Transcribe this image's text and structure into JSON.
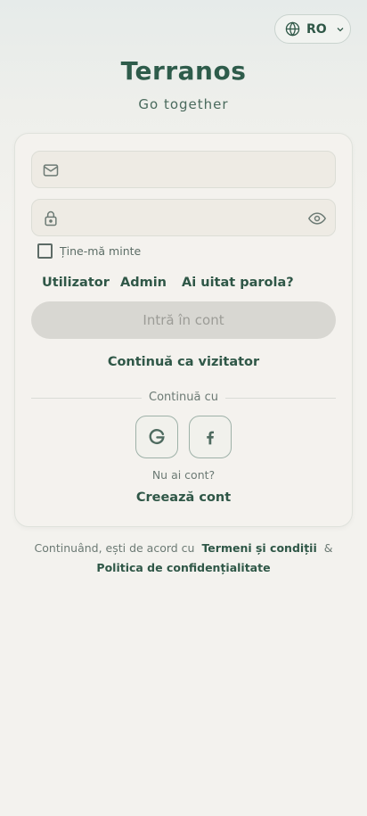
{
  "language": {
    "code": "RO",
    "icon": "globe-icon"
  },
  "app": {
    "title": "Terranos",
    "subtitle": "Go together"
  },
  "login": {
    "email": {
      "value": "",
      "placeholder": "",
      "icon": "mail-icon"
    },
    "password": {
      "value": "",
      "placeholder": "",
      "icon": "lock-icon",
      "toggle_icon": "eye-icon"
    },
    "remember_me": {
      "label": "Ține-mă minte",
      "checked": false
    },
    "role_links": [
      "Utilizator",
      "Admin"
    ],
    "forgot_password": "Ai uitat parola?",
    "submit": "Intră în cont",
    "guest": "Continuă ca vizitator",
    "divider": "Continuă cu",
    "social": [
      "google-icon",
      "facebook-icon"
    ],
    "no_account": "Nu ai cont?",
    "create_account": "Creează cont"
  },
  "legal": {
    "prefix": "Continuând, ești de acord cu",
    "terms": "Termeni și condiții",
    "and": "&",
    "privacy": "Politica de confidențialitate"
  },
  "colors": {
    "brand": "#2e5c4b",
    "button_disabled": "#d8d7d2",
    "background": "#f3f2ee"
  }
}
